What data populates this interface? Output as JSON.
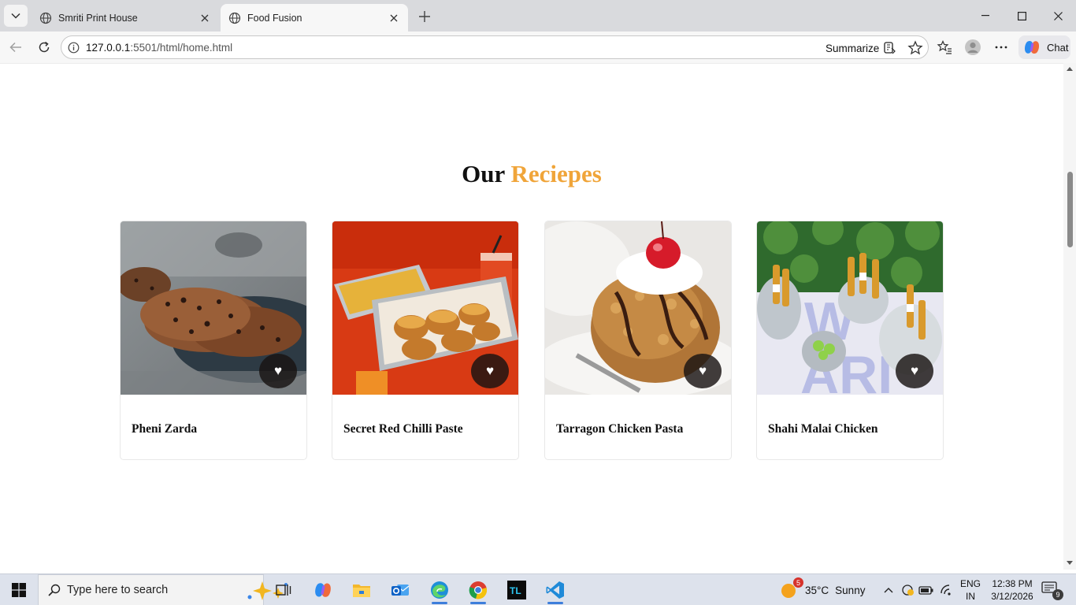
{
  "browser": {
    "tabs": [
      {
        "title": "Smriti Print House",
        "active": false
      },
      {
        "title": "Food Fusion",
        "active": true
      }
    ],
    "url_host": "127.0.0.1",
    "url_rest": ":5501/html/home.html",
    "summarize_label": "Summarize",
    "chat_label": "Chat"
  },
  "page": {
    "title_plain": "Our",
    "title_accent": "Reciepes",
    "accent_color": "#f0a53a",
    "recipes": [
      {
        "name": "Pheni Zarda",
        "image": "cookies-photo"
      },
      {
        "name": "Secret Red Chilli Paste",
        "image": "burger-tray-photo"
      },
      {
        "name": "Tarragon Chicken Pasta",
        "image": "dessert-cherry-photo"
      },
      {
        "name": "Shahi Malai Chicken",
        "image": "drinks-bucket-photo"
      }
    ],
    "favorite_icon": "heart-icon"
  },
  "taskbar": {
    "search_placeholder": "Type here to search",
    "weather_temp": "35°C",
    "weather_text": "Sunny",
    "weather_badge": "5",
    "lang_line1": "ENG",
    "lang_line2": "IN",
    "time": "12:38 PM",
    "date": "3/12/2026",
    "notification_count": "9"
  }
}
